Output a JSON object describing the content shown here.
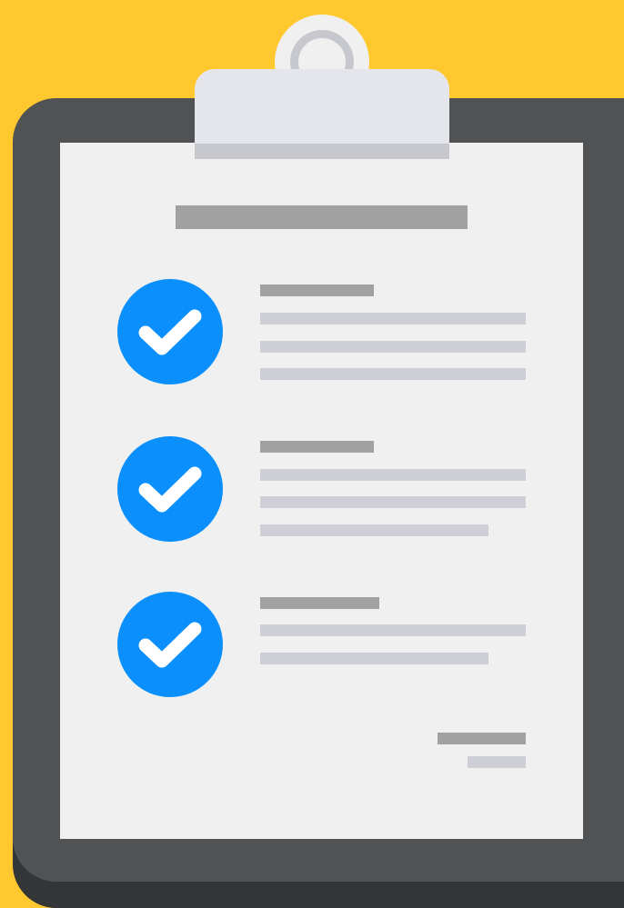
{
  "colors": {
    "background": "#FFC82E",
    "board": "#515254",
    "board_shadow": "#343537",
    "paper": "#F0F0F0",
    "clip_body": "#E4E6EB",
    "clip_shade": "#C6C8CE",
    "clip_ring_outer": "#F0F0F0",
    "clip_ring_inner": "#C6C8CE",
    "heading_placeholder": "#A2A1A2",
    "line_placeholder": "#CECFD6",
    "check_circle": "#0A8FFC",
    "check_mark": "#FFFFFF"
  },
  "icons": {
    "checklist_item": "check-circle-icon",
    "clip": "clipboard-clip-icon"
  },
  "checklist": {
    "items": [
      {
        "checked": true,
        "heading_placeholder": "short-bar",
        "line_placeholders": 3
      },
      {
        "checked": true,
        "heading_placeholder": "short-bar",
        "line_placeholders": 3
      },
      {
        "checked": true,
        "heading_placeholder": "short-bar",
        "line_placeholders": 2
      }
    ]
  }
}
